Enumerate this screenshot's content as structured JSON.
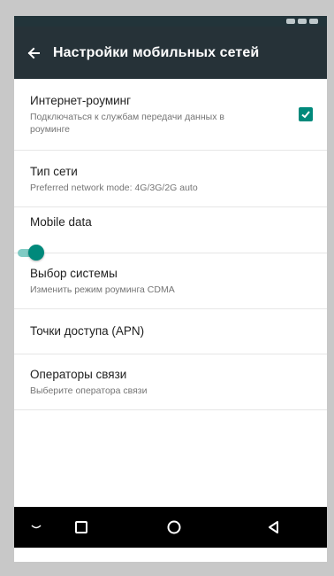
{
  "app_bar": {
    "title": "Настройки мобильных сетей",
    "back_icon": "arrow-left-icon"
  },
  "settings": [
    {
      "title": "Интернет-роуминг",
      "summary": "Подключаться к службам передачи данных в роуминге",
      "control": "checkbox",
      "checked": true
    },
    {
      "title": "Тип сети",
      "summary": "Preferred network mode: 4G/3G/2G auto"
    },
    {
      "title": "Mobile data",
      "summary": "",
      "control": "toggle",
      "enabled": true
    },
    {
      "title": "Выбор системы",
      "summary": "Изменить режим роуминга CDMA"
    },
    {
      "title": "Точки доступа (APN)",
      "summary": ""
    },
    {
      "title": "Операторы связи",
      "summary": "Выберите оператора связи"
    }
  ],
  "nav_bar": {
    "buttons": [
      "keyboard-hide-icon",
      "recents-square-icon",
      "home-circle-icon",
      "back-triangle-icon"
    ]
  },
  "colors": {
    "app_bar": "#263238",
    "accent": "#00897b",
    "accent_light": "#80cbc4",
    "nav_bar": "#000000"
  }
}
